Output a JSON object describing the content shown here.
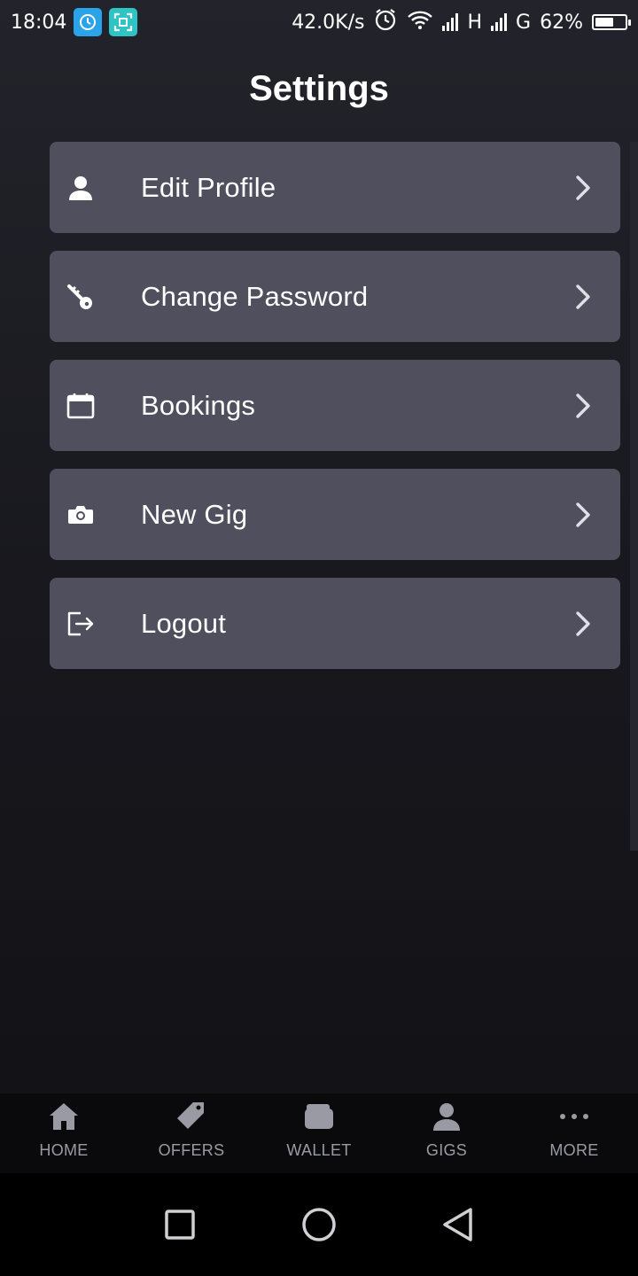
{
  "status_bar": {
    "time": "18:04",
    "network_speed": "42.0K/s",
    "network_type_1": "H",
    "network_type_2": "G",
    "battery": "62%"
  },
  "page": {
    "title": "Settings"
  },
  "settings": {
    "items": [
      {
        "label": "Edit Profile",
        "icon": "user-icon"
      },
      {
        "label": "Change Password",
        "icon": "key-icon"
      },
      {
        "label": "Bookings",
        "icon": "calendar-icon"
      },
      {
        "label": "New Gig",
        "icon": "camera-icon"
      },
      {
        "label": "Logout",
        "icon": "logout-icon"
      }
    ]
  },
  "bottom_nav": {
    "items": [
      {
        "label": "HOME",
        "icon": "home-icon"
      },
      {
        "label": "OFFERS",
        "icon": "tag-icon"
      },
      {
        "label": "WALLET",
        "icon": "wallet-icon"
      },
      {
        "label": "GIGS",
        "icon": "user-icon"
      },
      {
        "label": "MORE",
        "icon": "more-dots-icon"
      }
    ]
  },
  "colors": {
    "card": "#4f4f5e",
    "nav_label": "#9a9aa4",
    "background_top": "#23232b",
    "background_bottom": "#111114"
  }
}
